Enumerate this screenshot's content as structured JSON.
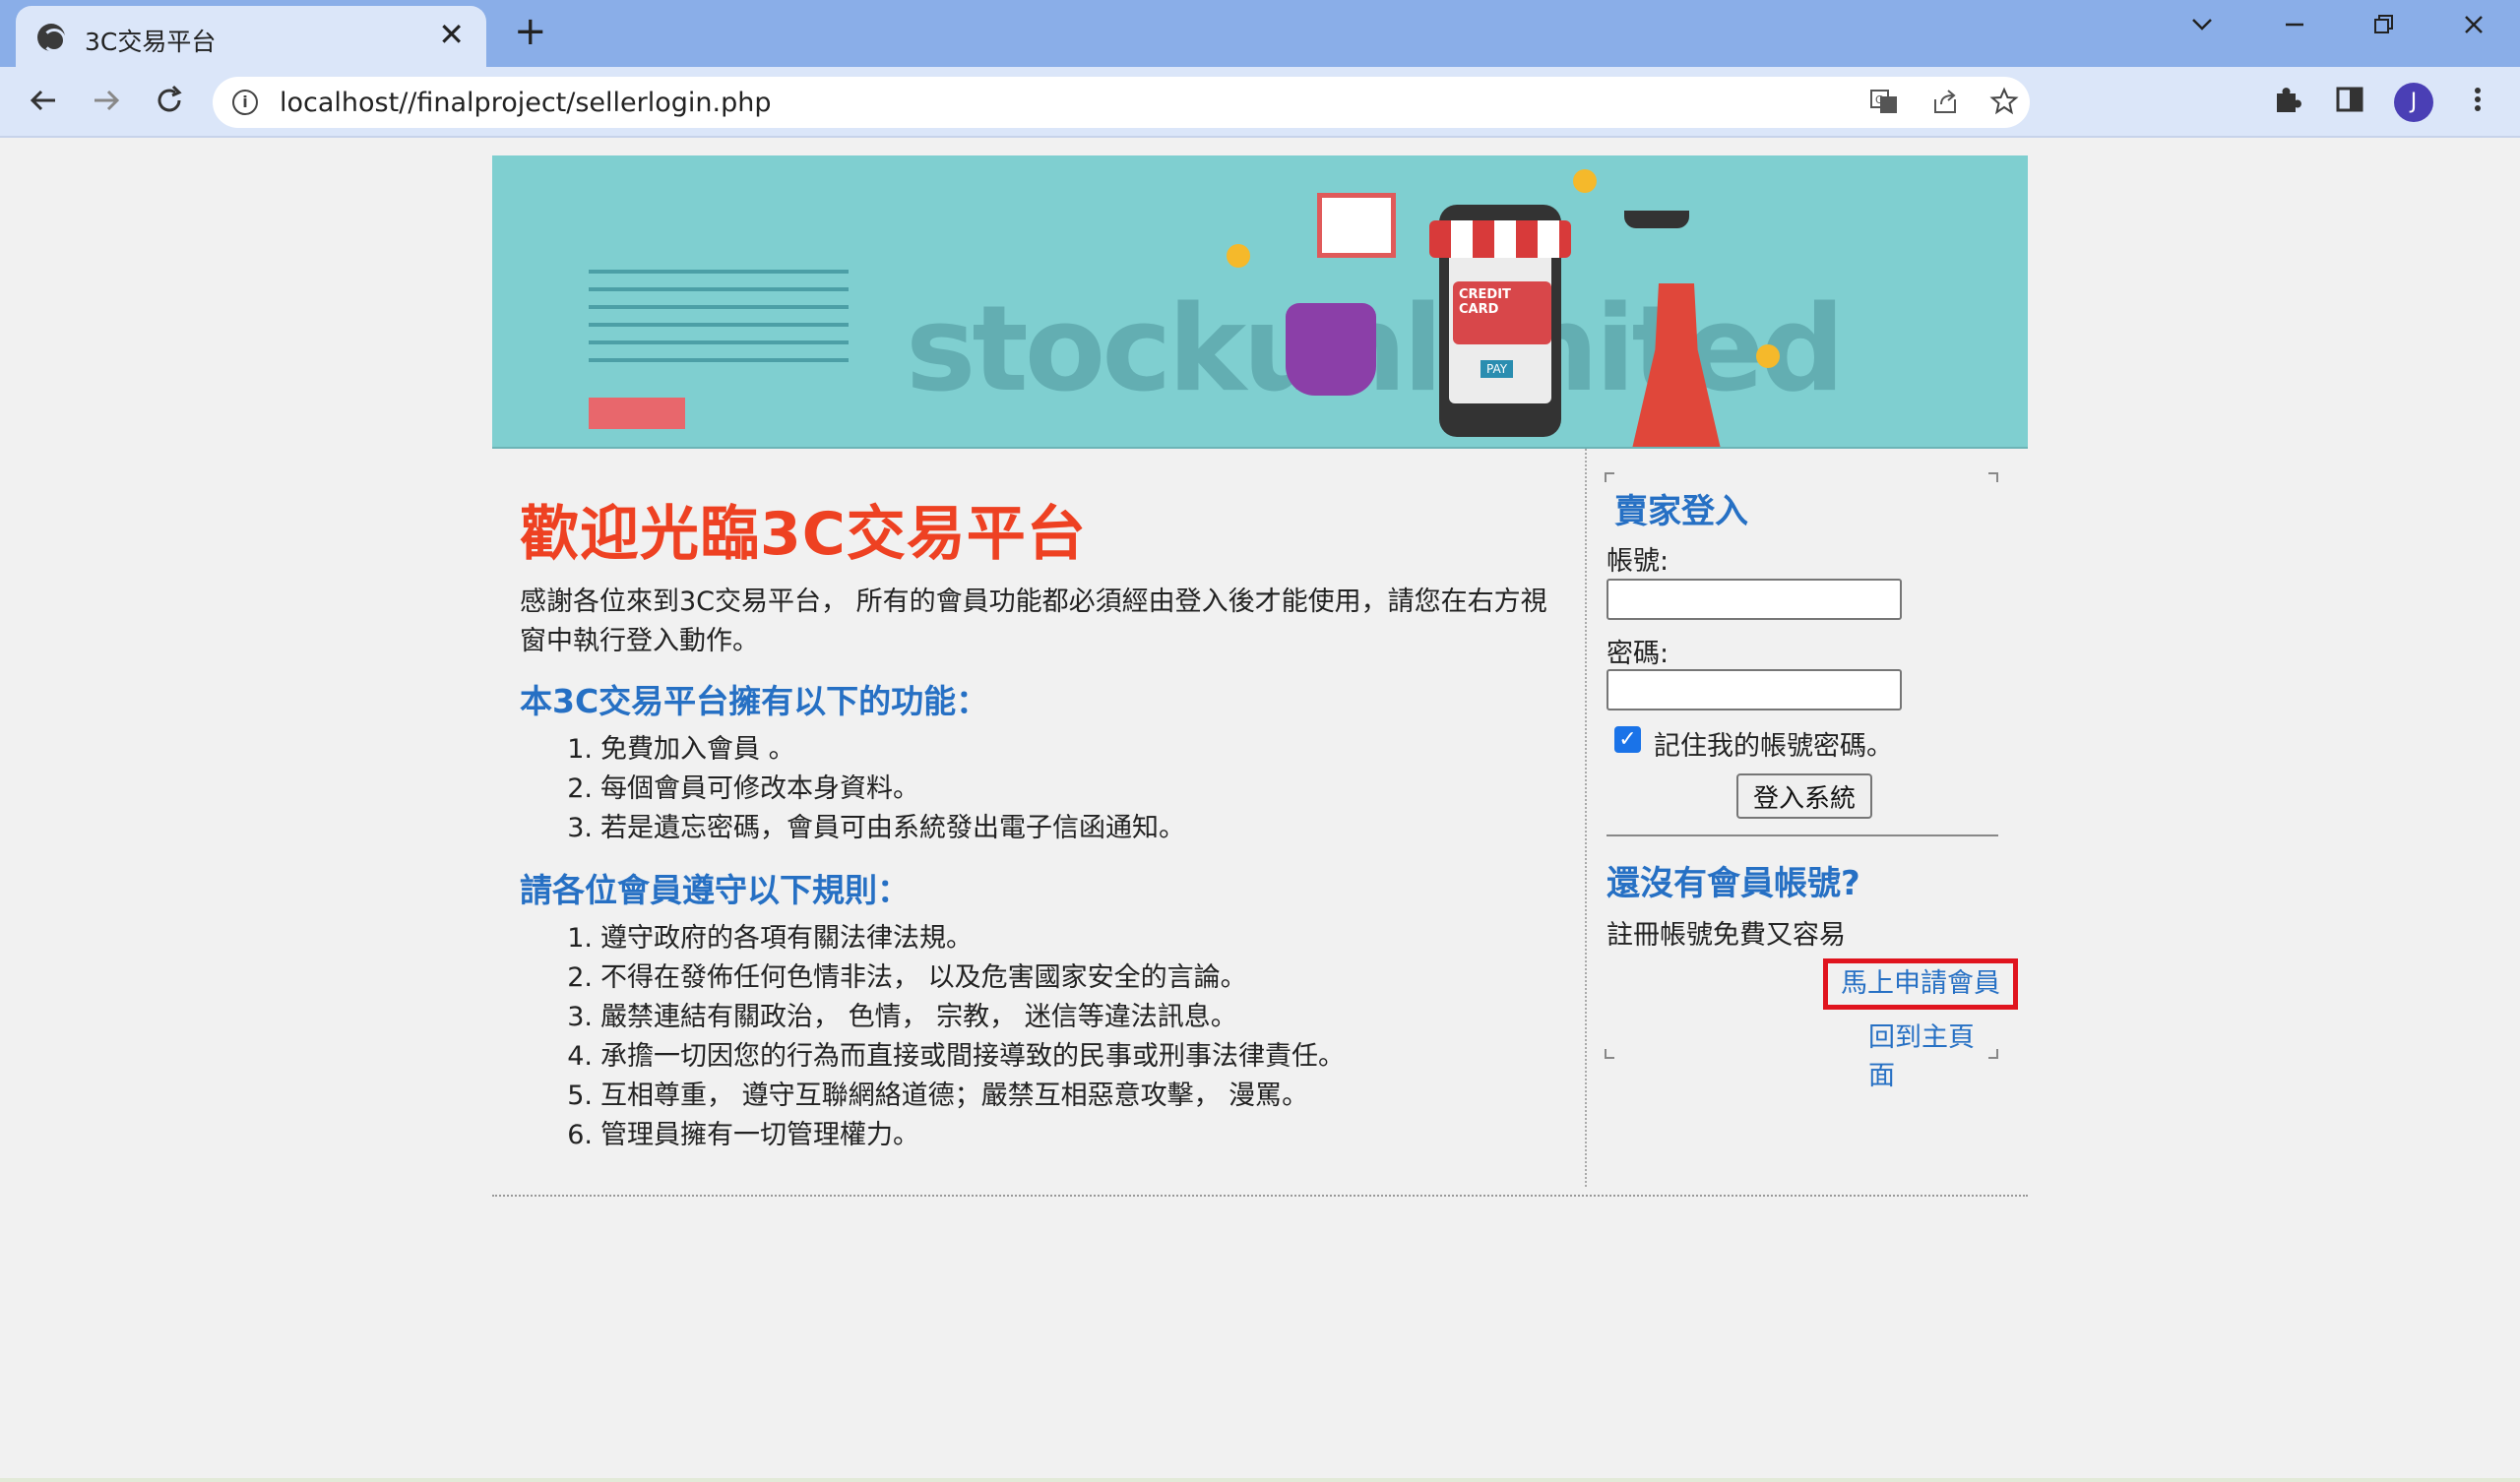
{
  "browser": {
    "tab_title": "3C交易平台",
    "tab_close": "✕",
    "new_tab": "+",
    "url": "localhost//finalproject/sellerlogin.php",
    "icons": [
      "globe-icon",
      "close-icon",
      "plus-icon",
      "chevron-down-icon",
      "minimize-icon",
      "restore-icon",
      "window-close-icon",
      "back-icon",
      "forward-icon",
      "reload-icon",
      "info-icon",
      "translate-icon",
      "share-icon",
      "star-icon",
      "extensions-icon",
      "sidebar-icon",
      "menu-icon"
    ],
    "profile_initial": "J"
  },
  "banner": {
    "watermark": "stockunlimited",
    "card_text": "CREDIT CARD",
    "pay_text": "PAY",
    "colors": {
      "background": "#7fcfd0",
      "accent_red": "#e8676c"
    }
  },
  "content": {
    "welcome": "歡迎光臨3C交易平台",
    "intro": "感謝各位來到3C交易平台， 所有的會員功能都必須經由登入後才能使用，請您在右方視窗中執行登入動作。",
    "features_heading": "本3C交易平台擁有以下的功能：",
    "features": [
      "免費加入會員 。",
      "每個會員可修改本身資料。",
      "若是遺忘密碼，會員可由系統發出電子信函通知。"
    ],
    "rules_heading": "請各位會員遵守以下規則：",
    "rules": [
      "遵守政府的各項有關法律法規。",
      "不得在發佈任何色情非法， 以及危害國家安全的言論。",
      "嚴禁連結有關政治， 色情， 宗教， 迷信等違法訊息。",
      "承擔一切因您的行為而直接或間接導致的民事或刑事法律責任。",
      "互相尊重， 遵守互聯網絡道德；嚴禁互相惡意攻擊， 漫罵。",
      "管理員擁有一切管理權力。"
    ]
  },
  "login": {
    "title": "賣家登入",
    "account_label": "帳號:",
    "account_value": "",
    "password_label": "密碼:",
    "password_value": "",
    "remember_label": "記住我的帳號密碼。",
    "remember_checked": true,
    "submit": "登入系統",
    "no_account": "還沒有會員帳號?",
    "free_text": "註冊帳號免費又容易",
    "apply_link": "馬上申請會員",
    "home_link": "回到主頁面"
  },
  "colors": {
    "heading_red": "#ee4122",
    "link_blue": "#2670c4",
    "highlight_red": "#e0141e"
  }
}
